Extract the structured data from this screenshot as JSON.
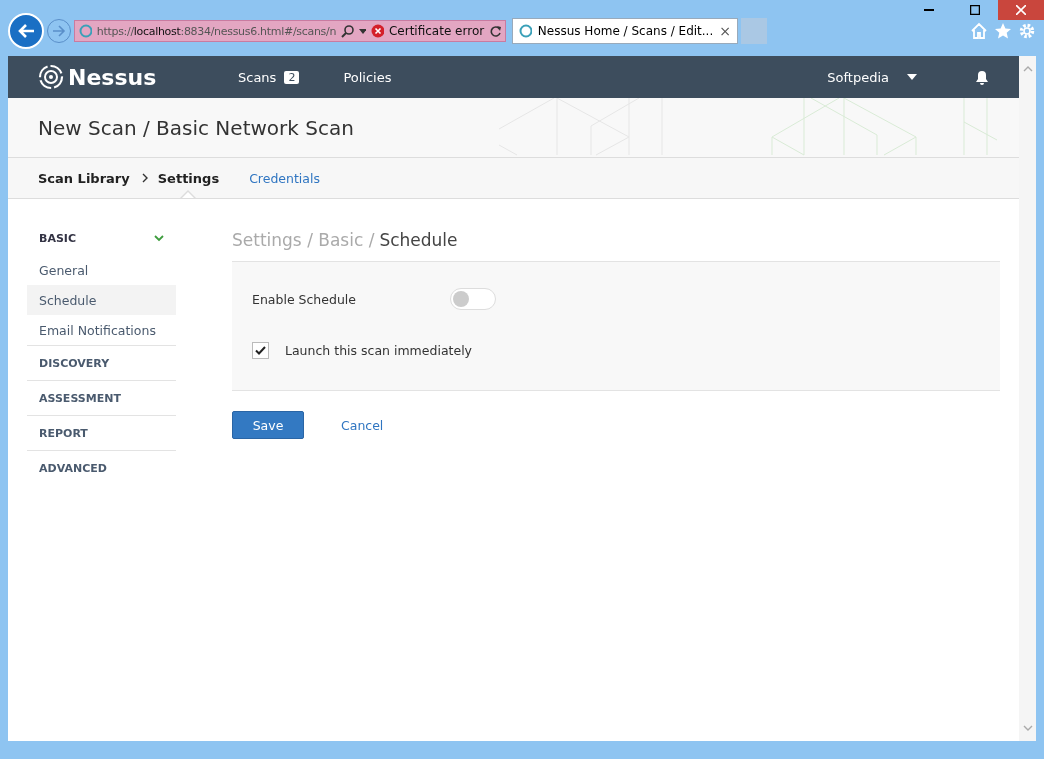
{
  "browser": {
    "address": "https://**localhost**:8834/nessus6.html#/scans/n",
    "certificate": "Certificate error",
    "tab": {
      "title": "Nessus Home / Scans / Edit...",
      "close": "×"
    }
  },
  "app": {
    "logo": "Nessus",
    "nav": [
      {
        "label": "Scans",
        "badge": "2"
      },
      {
        "label": "Policies"
      }
    ],
    "user": "Softpedia"
  },
  "title": "New Scan / Basic Network Scan",
  "tabs": [
    {
      "label": "Scan Library",
      "kind": "crumb"
    },
    {
      "label": "Settings",
      "kind": "tab",
      "selected": true
    },
    {
      "label": "Credentials",
      "kind": "tab",
      "selected": false
    }
  ],
  "sidebar": [
    {
      "label": "BASIC",
      "expanded": true,
      "children": [
        {
          "label": "General",
          "selected": false
        },
        {
          "label": "Schedule",
          "selected": true
        },
        {
          "label": "Email Notifications",
          "selected": false
        }
      ]
    },
    {
      "label": "DISCOVERY",
      "expanded": false
    },
    {
      "label": "ASSESSMENT",
      "expanded": false
    },
    {
      "label": "REPORT",
      "expanded": false
    },
    {
      "label": "ADVANCED",
      "expanded": false
    }
  ],
  "content": {
    "path_parent": "Settings / Basic /",
    "path_current": "Schedule",
    "fields": [
      {
        "kind": "toggle",
        "label": "Enable Schedule",
        "on": false
      },
      {
        "kind": "checkbox",
        "label": "Launch this scan immediately",
        "checked": true
      }
    ],
    "buttons": [
      {
        "kind": "primary",
        "label": "Save"
      },
      {
        "kind": "link",
        "label": "Cancel"
      }
    ]
  }
}
